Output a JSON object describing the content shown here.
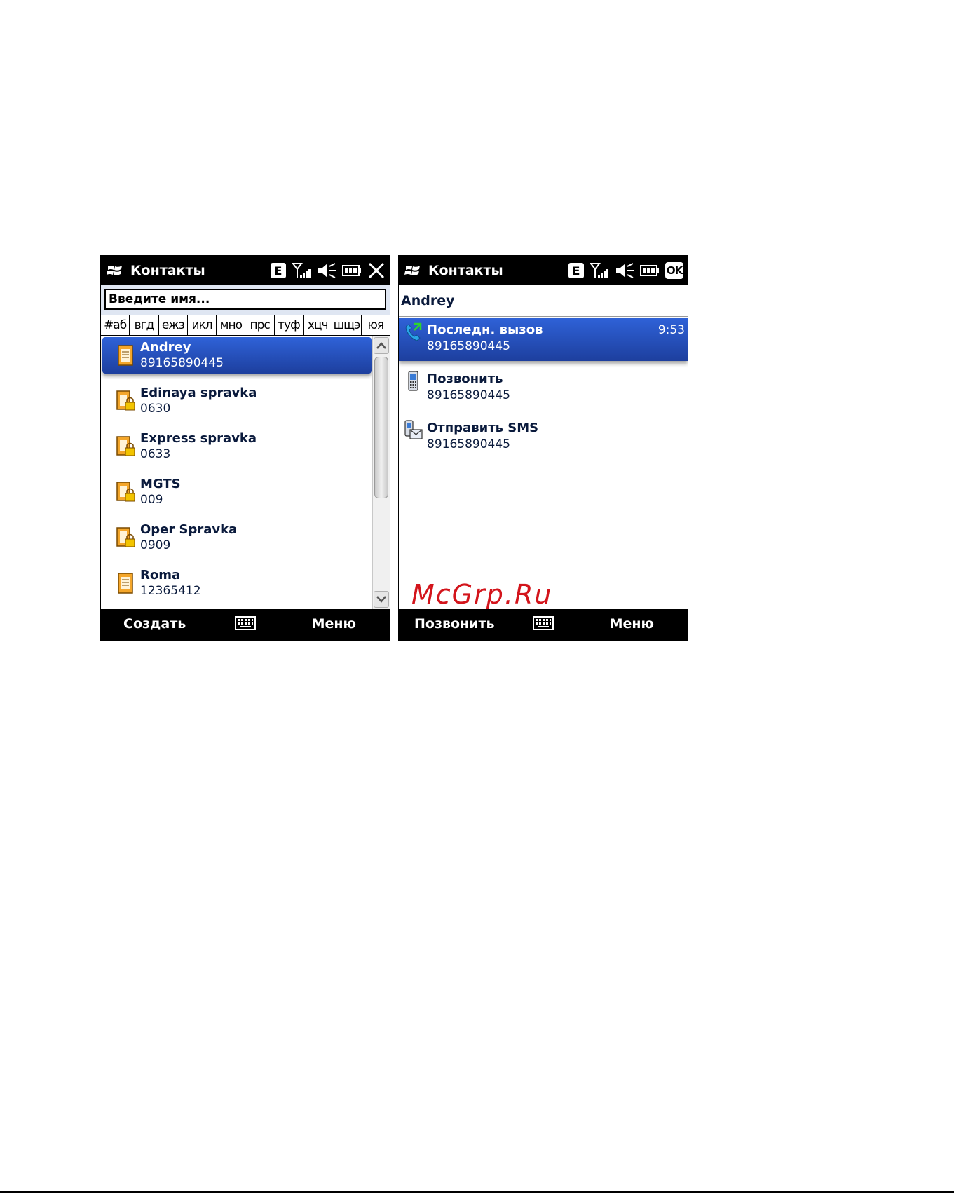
{
  "left_screen": {
    "title": "Контакты",
    "network_badge": "E",
    "icons": [
      "windows-logo-icon",
      "signal-icon",
      "speaker-muted-icon",
      "battery-icon",
      "close-icon"
    ],
    "search": {
      "placeholder": "Введите имя..."
    },
    "letter_groups": [
      "#аб",
      "вгд",
      "ежз",
      "икл",
      "мно",
      "прс",
      "туф",
      "хцч",
      "шщэ",
      "юя"
    ],
    "contacts": [
      {
        "name": "Andrey",
        "number": "89165890445",
        "selected": true
      },
      {
        "name": "Edinaya spravka",
        "number": "0630"
      },
      {
        "name": "Express spravka",
        "number": "0633"
      },
      {
        "name": "MGTS",
        "number": "009"
      },
      {
        "name": "Oper Spravka",
        "number": "0909"
      },
      {
        "name": "Roma",
        "number": "12365412"
      }
    ],
    "softkeys": {
      "left": "Создать",
      "right": "Меню"
    }
  },
  "right_screen": {
    "title": "Контакты",
    "network_badge": "E",
    "ok_label": "OK",
    "icons": [
      "windows-logo-icon",
      "signal-icon",
      "speaker-muted-icon",
      "battery-icon"
    ],
    "contact_name": "Andrey",
    "actions": [
      {
        "label": "Последн. вызов",
        "number": "89165890445",
        "time": "9:53",
        "icon": "phone-call-icon",
        "selected": true
      },
      {
        "label": "Позвонить",
        "number": "89165890445",
        "icon": "mobile-phone-icon"
      },
      {
        "label": "Отправить SMS",
        "number": "89165890445",
        "icon": "sms-message-icon"
      }
    ],
    "softkeys": {
      "left": "Позвонить",
      "right": "Меню"
    }
  },
  "watermark": "McGrp.Ru",
  "colors": {
    "selection": "#2f62d8",
    "titlebar": "#000000",
    "text": "#0a1a3c",
    "watermark": "#d3141b"
  }
}
